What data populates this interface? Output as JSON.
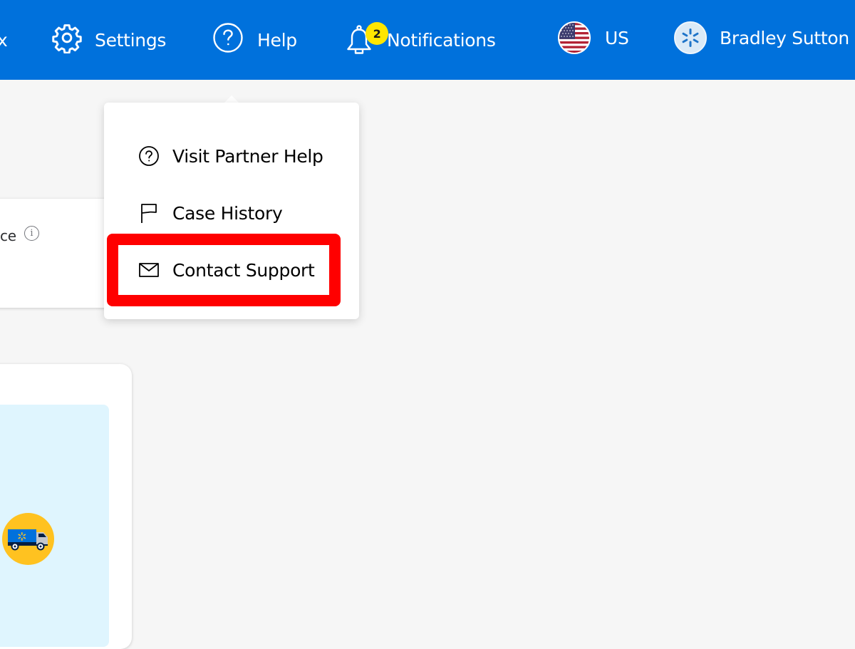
{
  "topbar": {
    "background_color": "#0071dc",
    "items": [
      {
        "label": "x",
        "icon": "truncated"
      },
      {
        "label": "Settings",
        "icon": "gear-icon"
      },
      {
        "label": "Help",
        "icon": "help-circle-icon"
      },
      {
        "label": "Notifications",
        "icon": "bell-icon",
        "badge": "2"
      },
      {
        "label": "US",
        "icon": "us-flag-icon"
      },
      {
        "label": "Bradley Sutton",
        "icon": "walmart-spark-avatar"
      }
    ]
  },
  "help_menu": {
    "items": [
      {
        "label": "Visit Partner Help",
        "icon": "help-circle-icon"
      },
      {
        "label": "Case History",
        "icon": "flag-icon"
      },
      {
        "label": "Contact Support",
        "icon": "mail-icon",
        "highlighted": true
      }
    ],
    "highlight_color": "#ff0000"
  },
  "background": {
    "card_partial_text": "ce",
    "info_icon_glyph": "i",
    "promo_panel_color": "#dff5fe",
    "truck_circle_color": "#ffc220"
  }
}
